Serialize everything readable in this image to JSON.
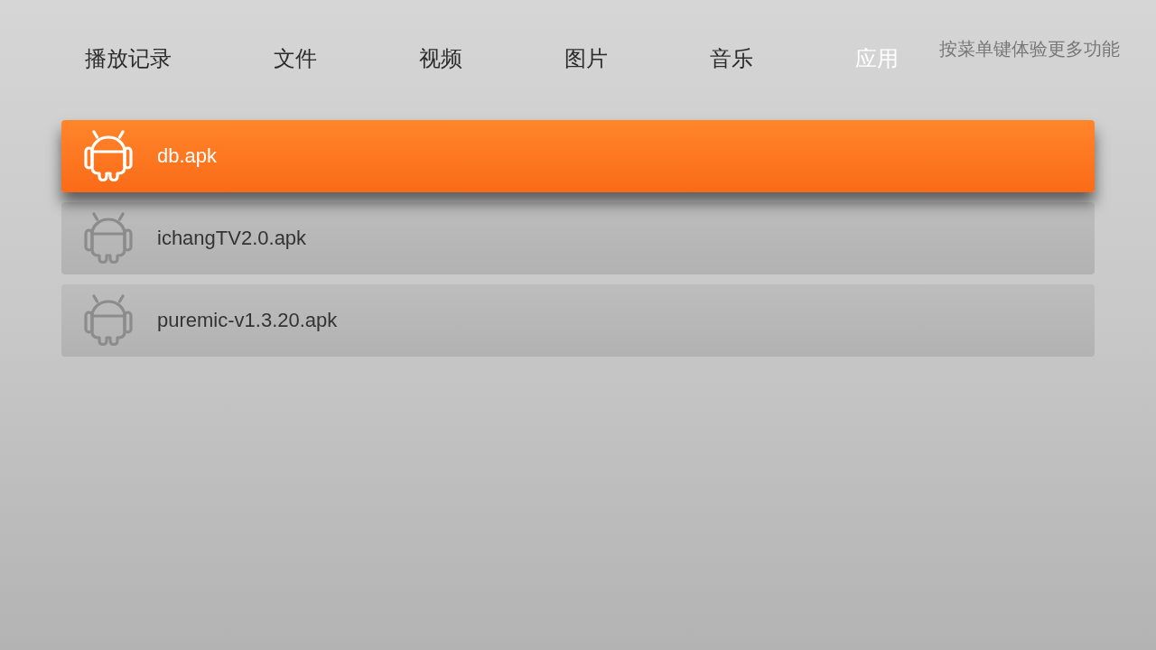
{
  "tabs": [
    {
      "label": "播放记录",
      "selected": false
    },
    {
      "label": "文件",
      "selected": false
    },
    {
      "label": "视频",
      "selected": false
    },
    {
      "label": "图片",
      "selected": false
    },
    {
      "label": "音乐",
      "selected": false
    },
    {
      "label": "应用",
      "selected": true
    }
  ],
  "hint": "按菜单键体验更多功能",
  "files": [
    {
      "name": "db.apk",
      "selected": true
    },
    {
      "name": "ichangTV2.0.apk",
      "selected": false
    },
    {
      "name": "puremic-v1.3.20.apk",
      "selected": false
    }
  ]
}
